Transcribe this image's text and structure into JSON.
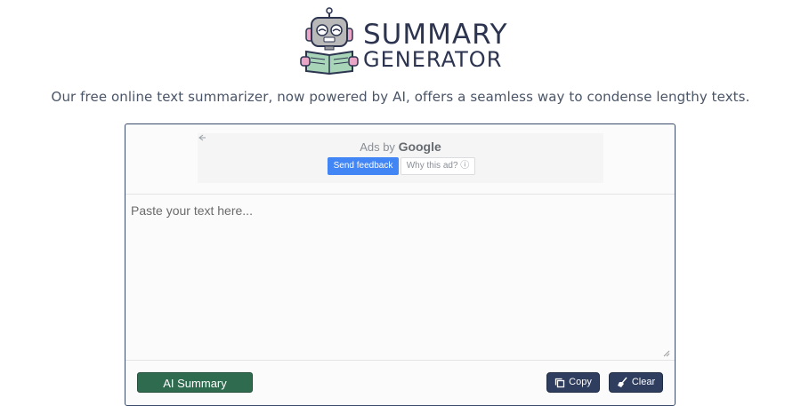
{
  "header": {
    "logo_line1": "SUMMARY",
    "logo_line2": "GENERATOR",
    "tagline": "Our free online text summarizer, now powered by AI, offers a seamless way to condense lengthy texts."
  },
  "ad": {
    "back_icon": "arrow-left-icon",
    "ads_by": "Ads by",
    "google": "Google",
    "send_feedback": "Send feedback",
    "why_this_ad": "Why this ad?",
    "info_icon": "ⓘ"
  },
  "editor": {
    "placeholder": "Paste your text here...",
    "value": ""
  },
  "actions": {
    "ai_summary": "AI Summary",
    "copy": "Copy",
    "clear": "Clear"
  },
  "colors": {
    "ai_button": "#2f6b4f",
    "dark_button": "#2f3d5e",
    "google_blue": "#4285f4",
    "border": "#3a4a6b"
  }
}
